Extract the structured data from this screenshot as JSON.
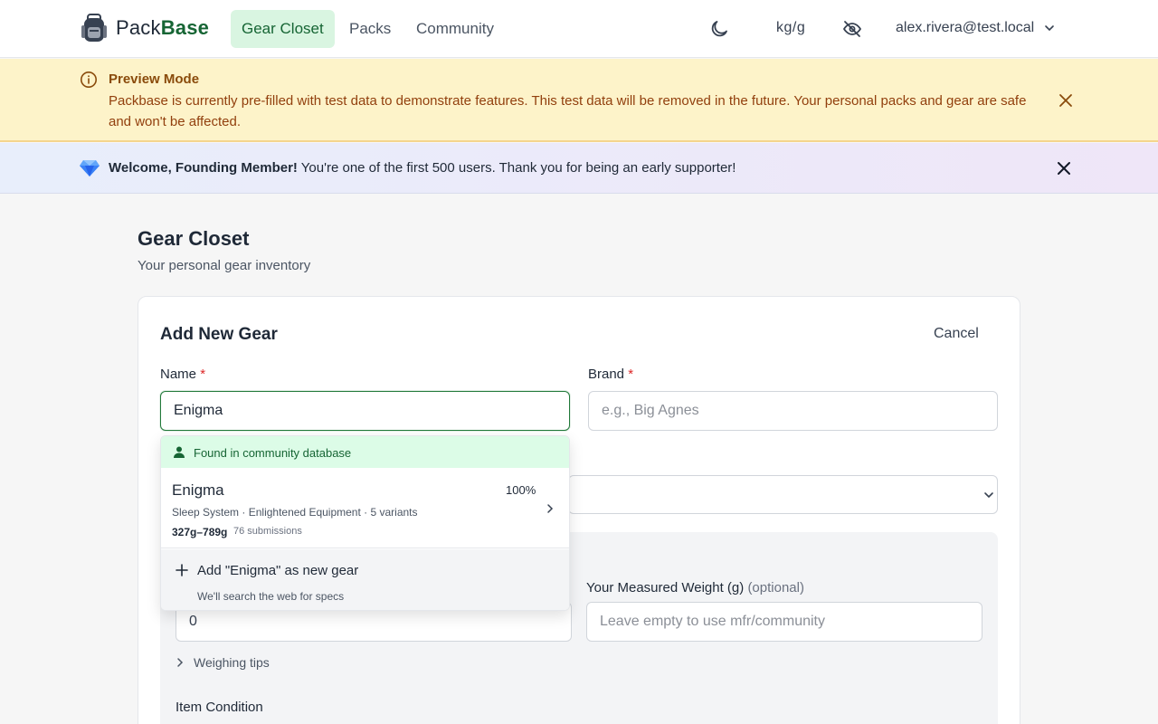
{
  "nav": {
    "logo_prefix": "Pack",
    "logo_suffix": "Base",
    "links": [
      {
        "label": "Gear Closet",
        "active": true
      },
      {
        "label": "Packs",
        "active": false
      },
      {
        "label": "Community",
        "active": false
      }
    ],
    "theme_icon": "moon-icon",
    "units_label": "kg/g",
    "privacy_icon": "eye-off-icon",
    "user_email": "alex.rivera@test.local"
  },
  "preview_banner": {
    "title": "Preview Mode",
    "body": "Packbase is currently pre-filled with test data to demonstrate features. This test data will be removed in the future. Your personal packs and gear are safe and won't be affected.",
    "icon": "info-icon"
  },
  "welcome_banner": {
    "bold": "Welcome, Founding Member!",
    "text": " You're one of the first 500 users. Thank you for being an early supporter!",
    "icon": "gem-icon"
  },
  "page": {
    "title": "Gear Closet",
    "subtitle": "Your personal gear inventory"
  },
  "form": {
    "title": "Add New Gear",
    "cancel_label": "Cancel",
    "name_label": "Name",
    "name_value": "Enigma",
    "brand_label": "Brand",
    "brand_placeholder": "e.g., Big Agnes",
    "required_mark": "*",
    "manufacturer_weight_value": "0",
    "measured_weight_label": "Your Measured Weight (g)",
    "measured_weight_optional": "(optional)",
    "measured_weight_placeholder": "Leave empty to use mfr/community",
    "weighing_tips_label": "Weighing tips",
    "item_condition_label": "Item Condition"
  },
  "suggestions": {
    "header": "Found in community database",
    "result": {
      "name": "Enigma",
      "match": "100%",
      "category": "Sleep System",
      "brand": "Enlightened Equipment",
      "variants": "5 variants",
      "weight_range": "327g–789g",
      "submissions": "76 submissions"
    },
    "add_label": "Add \"Enigma\" as new gear",
    "add_sub": "We'll search the web for specs"
  },
  "colors": {
    "brand_green": "#166534",
    "active_nav_bg": "#d9f5e1",
    "preview_bg": "#fdf3c9",
    "preview_text": "#92400e",
    "required": "#dc2626"
  }
}
